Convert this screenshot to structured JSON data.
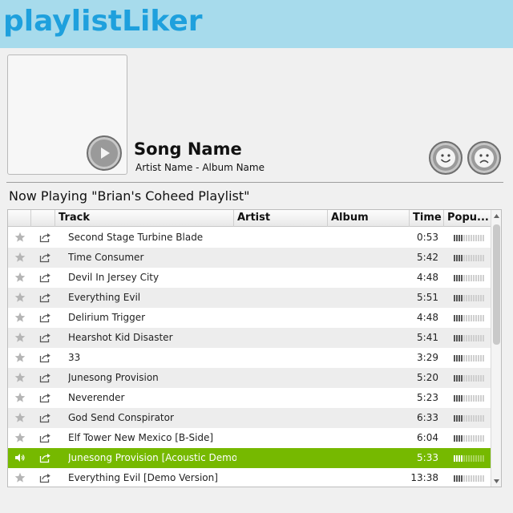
{
  "app": {
    "title": "playlistLiker"
  },
  "now_playing": {
    "song_name": "Song Name",
    "meta": "Artist Name - Album Name"
  },
  "playlist": {
    "heading": "Now Playing \"Brian's Coheed Playlist\"",
    "columns": {
      "track": "Track",
      "artist": "Artist",
      "album": "Album",
      "time": "Time",
      "popularity": "Popu..."
    },
    "rows": [
      {
        "track": "Second Stage Turbine Blade",
        "time": "0:53",
        "popularity": 0.3,
        "playing": false
      },
      {
        "track": "Time Consumer",
        "time": "5:42",
        "popularity": 0.3,
        "playing": false
      },
      {
        "track": "Devil In Jersey City",
        "time": "4:48",
        "popularity": 0.3,
        "playing": false
      },
      {
        "track": "Everything Evil",
        "time": "5:51",
        "popularity": 0.3,
        "playing": false
      },
      {
        "track": "Delirium Trigger",
        "time": "4:48",
        "popularity": 0.3,
        "playing": false
      },
      {
        "track": "Hearshot Kid Disaster",
        "time": "5:41",
        "popularity": 0.3,
        "playing": false
      },
      {
        "track": "33",
        "time": "3:29",
        "popularity": 0.3,
        "playing": false
      },
      {
        "track": "Junesong Provision",
        "time": "5:20",
        "popularity": 0.3,
        "playing": false
      },
      {
        "track": "Neverender",
        "time": "5:23",
        "popularity": 0.3,
        "playing": false
      },
      {
        "track": "God Send Conspirator",
        "time": "6:33",
        "popularity": 0.3,
        "playing": false
      },
      {
        "track": "Elf Tower New Mexico [B-Side]",
        "time": "6:04",
        "popularity": 0.3,
        "playing": false
      },
      {
        "track": "Junesong Provision [Acoustic Demo",
        "time": "5:33",
        "popularity": 0.3,
        "playing": true
      },
      {
        "track": "Everything Evil [Demo Version]",
        "time": "13:38",
        "popularity": 0.3,
        "playing": false
      }
    ]
  },
  "colors": {
    "header_bg": "#a7dbec",
    "title": "#1ea0dd",
    "active_row": "#76b900"
  },
  "icons": {
    "star": "star-icon",
    "share": "share-icon",
    "speaker": "speaker-icon",
    "play": "play-icon",
    "smile": "smile-icon",
    "frown": "frown-icon"
  }
}
